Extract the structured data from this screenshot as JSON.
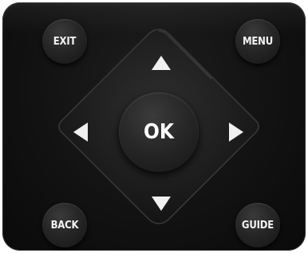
{
  "buttons": {
    "exit": "EXIT",
    "menu": "MENU",
    "back": "BACK",
    "guide": "GUIDE",
    "ok": "OK"
  },
  "icons": {
    "up": "arrow-up-icon",
    "down": "arrow-down-icon",
    "left": "arrow-left-icon",
    "right": "arrow-right-icon"
  },
  "colors": {
    "body": "#121212",
    "button": "#262626",
    "label": "#f2f2f2"
  }
}
